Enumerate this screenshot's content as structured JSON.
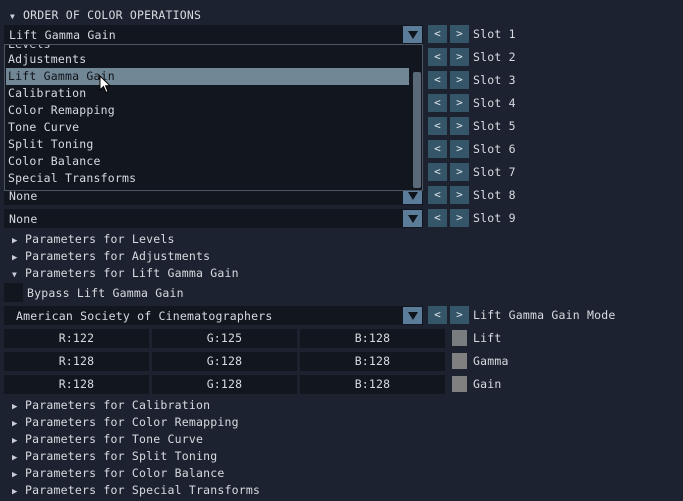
{
  "header": {
    "title": "ORDER OF COLOR OPERATIONS"
  },
  "slots": [
    {
      "value": "Lift Gamma Gain",
      "label": "Slot 1"
    },
    {
      "value": "",
      "label": "Slot 2"
    },
    {
      "value": "",
      "label": "Slot 3"
    },
    {
      "value": "",
      "label": "Slot 4"
    },
    {
      "value": "",
      "label": "Slot 5"
    },
    {
      "value": "",
      "label": "Slot 6"
    },
    {
      "value": "",
      "label": "Slot 7"
    },
    {
      "value": "None",
      "label": "Slot 8"
    },
    {
      "value": "None",
      "label": "Slot 9"
    }
  ],
  "buttons": {
    "prev": "<",
    "next": ">"
  },
  "dropdown": {
    "cut_item": "Levels",
    "items": [
      "Adjustments",
      "Lift Gamma Gain",
      "Calibration",
      "Color Remapping",
      "Tone Curve",
      "Split Toning",
      "Color Balance",
      "Special Transforms"
    ],
    "highlighted": "Lift Gamma Gain"
  },
  "params_top": [
    {
      "label": "Parameters for Levels",
      "expanded": false
    },
    {
      "label": "Parameters for Adjustments",
      "expanded": false
    },
    {
      "label": "Parameters for Lift Gamma Gain",
      "expanded": true
    }
  ],
  "lgg": {
    "bypass_label": "Bypass Lift Gamma Gain",
    "mode_value": "American Society of Cinematographers",
    "mode_label": "Lift Gamma Gain Mode",
    "rows": [
      {
        "r": "R:122",
        "g": "G:125",
        "b": "B:128",
        "label": "Lift",
        "color": "#7a7d80"
      },
      {
        "r": "R:128",
        "g": "G:128",
        "b": "B:128",
        "label": "Gamma",
        "color": "#808080"
      },
      {
        "r": "R:128",
        "g": "G:128",
        "b": "B:128",
        "label": "Gain",
        "color": "#808080"
      }
    ]
  },
  "params_bottom": [
    {
      "label": "Parameters for Calibration",
      "expanded": false
    },
    {
      "label": "Parameters for Color Remapping",
      "expanded": false
    },
    {
      "label": "Parameters for Tone Curve",
      "expanded": false
    },
    {
      "label": "Parameters for Split Toning",
      "expanded": false
    },
    {
      "label": "Parameters for Color Balance",
      "expanded": false
    },
    {
      "label": "Parameters for Special Transforms",
      "expanded": false
    }
  ],
  "colors": {
    "accent": "#5b7d9a",
    "button": "#355669",
    "selection": "#728796",
    "background": "#1c2230",
    "field": "#12171f"
  }
}
